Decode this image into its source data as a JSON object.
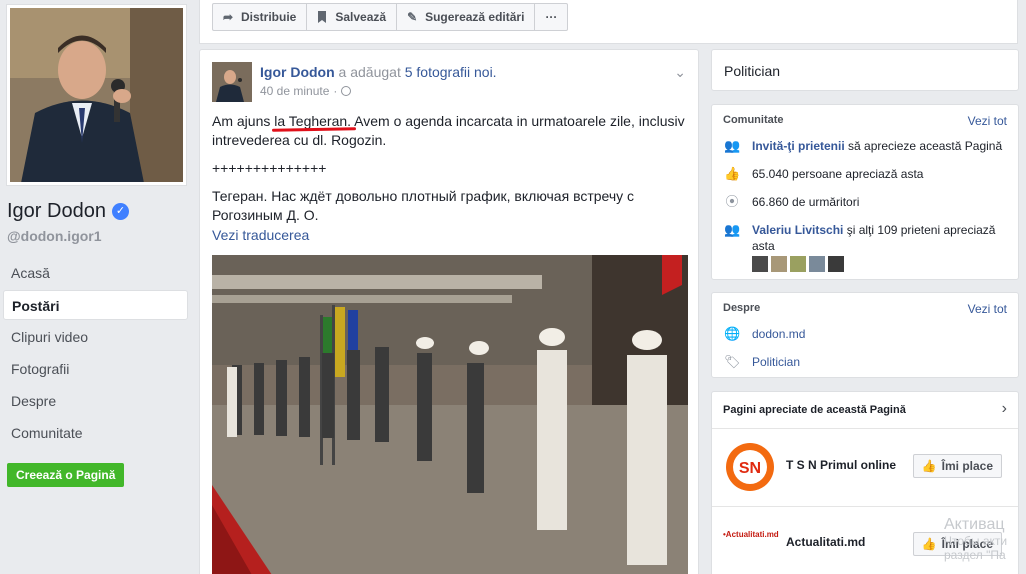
{
  "sidebar": {
    "page_name": "Igor Dodon",
    "handle": "@dodon.igor1",
    "nav": [
      {
        "label": "Acasă"
      },
      {
        "label": "Postări"
      },
      {
        "label": "Clipuri video"
      },
      {
        "label": "Fotografii"
      },
      {
        "label": "Despre"
      },
      {
        "label": "Comunitate"
      }
    ],
    "create_page": "Creează o Pagină"
  },
  "toolbar": {
    "share": "Distribuie",
    "save": "Salvează",
    "suggest_edits": "Sugerează editări",
    "more": "···"
  },
  "post": {
    "author": "Igor Dodon",
    "action_prefix": "a adăugat",
    "action_link": "5 fotografii noi.",
    "time": "40 de minute",
    "text_ro_start": "Am ajuns ",
    "text_ro_underlined": "la Tegheran.",
    "text_ro_end": " Avem o agenda incarcata in urmatoarele zile, inclusiv intrevederea cu dl. Rogozin.",
    "separator": "++++++++++++++",
    "text_ru": "Тегеран. Нас ждёт довольно плотный график, включая встречу с Рогозиным Д. О.",
    "see_translation": "Vezi traducerea"
  },
  "category": {
    "label": "Politician"
  },
  "community": {
    "title": "Comunitate",
    "see_all": "Vezi tot",
    "invite_link": "Invită-ţi prietenii",
    "invite_rest": "să aprecieze această Pagină",
    "likes": "65.040 persoane apreciază asta",
    "followers": "66.860 de urmăritori",
    "friend_name": "Valeriu Livitschi",
    "friend_rest": "şi alţi 109 prieteni apreciază asta"
  },
  "about": {
    "title": "Despre",
    "see_all": "Vezi tot",
    "website": "dodon.md",
    "category": "Politician"
  },
  "liked_pages": {
    "title": "Pagini apreciate de această Pagină",
    "items": [
      {
        "name": "T S N Primul online",
        "button": "Îmi place"
      },
      {
        "name": "Actualitati.md",
        "logo_text": "•Actualitati.md",
        "button": "Îmi place"
      }
    ]
  },
  "watermark": {
    "line1": "Активац",
    "line2": "Чтобы акти",
    "line3": "раздел \"Па"
  },
  "colors": {
    "link": "#365899",
    "green": "#42b72a",
    "underline_red": "#e0101a"
  }
}
